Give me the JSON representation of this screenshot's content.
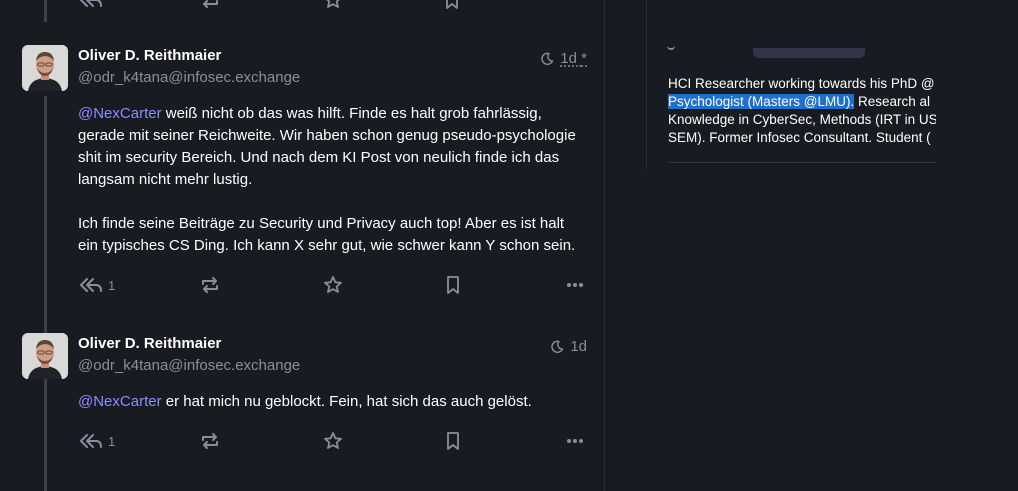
{
  "colors": {
    "background": "#191b22",
    "muted": "#8a8d9e",
    "mention": "#8c8dff",
    "highlight": "#1f6fd1",
    "thread_line": "#3d3f4a"
  },
  "posts": [
    {
      "display_name": "Oliver D. Reithmaier",
      "handle": "@odr_k4tana@infosec.exchange",
      "visibility_icon": "moon-icon",
      "time": "1d",
      "edited_marker": "*",
      "paragraphs": [
        {
          "mention": "@NexCarter",
          "text": " weiß nicht ob das was hilft. Finde es halt grob fahrlässig, gerade mit seiner Reichweite. Wir haben schon genug pseudo-psychologie shit im security Bereich. Und nach dem KI Post von neulich finde ich das langsam nicht mehr lustig."
        },
        {
          "mention": "",
          "text": "Ich finde seine Beiträge zu Security und Privacy auch top! Aber es ist halt ein typisches CS Ding. Ich kann X sehr gut, wie schwer kann Y schon sein."
        }
      ],
      "reply_count": "1"
    },
    {
      "display_name": "Oliver D. Reithmaier",
      "handle": "@odr_k4tana@infosec.exchange",
      "visibility_icon": "moon-icon",
      "time": "1d",
      "paragraphs": [
        {
          "mention": "@NexCarter",
          "text": " er hat mich nu geblockt. Fein, hat sich das auch gelöst."
        }
      ],
      "reply_count": "1"
    }
  ],
  "sidebar": {
    "bio_lines": [
      {
        "text": "HCI Researcher working towards his PhD @",
        "highlight": ""
      },
      {
        "text": " Research al",
        "highlight": "Psychologist (Masters @LMU)."
      },
      {
        "text": "Knowledge in CyberSec, Methods (IRT in US",
        "highlight": ""
      },
      {
        "text": "SEM). Former Infosec Consultant. Student (",
        "highlight": ""
      }
    ]
  }
}
